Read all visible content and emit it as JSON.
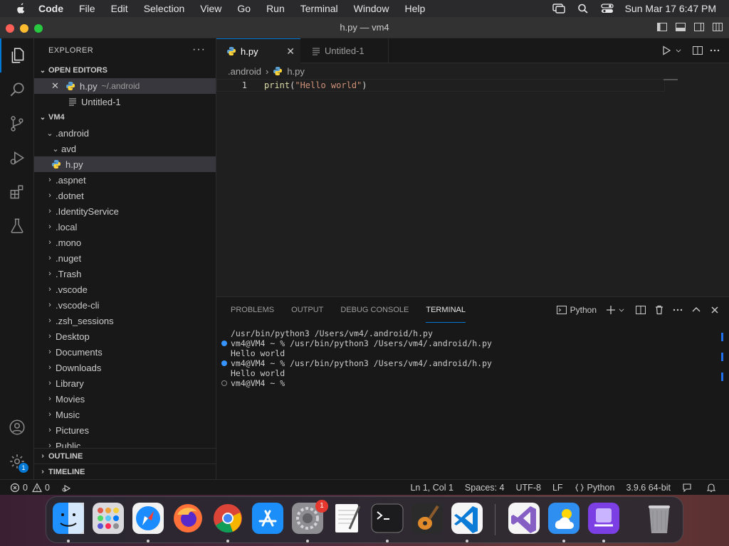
{
  "menubar": {
    "app_name": "Code",
    "items": [
      "File",
      "Edit",
      "Selection",
      "View",
      "Go",
      "Run",
      "Terminal",
      "Window",
      "Help"
    ],
    "clock": "Sun Mar 17  6:47 PM"
  },
  "window": {
    "title": "h.py — vm4"
  },
  "explorer": {
    "header": "EXPLORER",
    "more": "···",
    "open_editors": {
      "label": "OPEN EDITORS",
      "items": [
        {
          "name": "h.py",
          "path": "~/.android"
        },
        {
          "name": "Untitled-1"
        }
      ]
    },
    "workspace": {
      "label": "VM4",
      "folders": [
        ".android",
        "avd"
      ],
      "file": "h.py",
      "items": [
        ".aspnet",
        ".dotnet",
        ".IdentityService",
        ".local",
        ".mono",
        ".nuget",
        ".Trash",
        ".vscode",
        ".vscode-cli",
        ".zsh_sessions",
        "Desktop",
        "Documents",
        "Downloads",
        "Library",
        "Movies",
        "Music",
        "Pictures",
        "Public"
      ]
    },
    "outline": "OUTLINE",
    "timeline": "TIMELINE"
  },
  "tabs": [
    {
      "label": "h.py"
    },
    {
      "label": "Untitled-1"
    }
  ],
  "breadcrumb": [
    ".android",
    "h.py"
  ],
  "editor": {
    "line_number": "1",
    "code": {
      "fn": "print",
      "open": "(",
      "str": "\"Hello world\"",
      "close": ")"
    }
  },
  "panel": {
    "tabs": [
      "PROBLEMS",
      "OUTPUT",
      "DEBUG CONSOLE",
      "TERMINAL"
    ],
    "active_tab": "TERMINAL",
    "terminal_name": "Python",
    "lines": [
      "/usr/bin/python3 /Users/vm4/.android/h.py",
      "vm4@VM4 ~ % /usr/bin/python3 /Users/vm4/.android/h.py",
      "Hello world",
      "vm4@VM4 ~ % /usr/bin/python3 /Users/vm4/.android/h.py",
      "Hello world",
      "vm4@VM4 ~ % "
    ]
  },
  "statusbar": {
    "errors": "0",
    "warnings": "0",
    "position": "Ln 1, Col 1",
    "spaces": "Spaces: 4",
    "encoding": "UTF-8",
    "eol": "LF",
    "language": "Python",
    "interpreter": "3.9.6 64-bit"
  },
  "activity": {
    "accounts_badge": "1"
  },
  "dock": {
    "settings_badge": "1"
  },
  "colors": {
    "accent": "#0078d4",
    "editor_bg": "#1f1f1f",
    "sidebar_bg": "#181818"
  }
}
